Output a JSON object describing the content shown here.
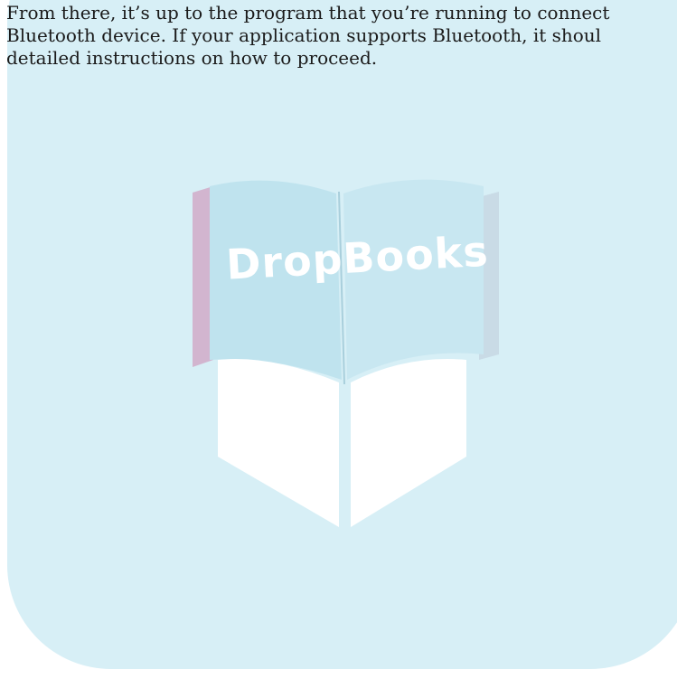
{
  "document": {
    "paragraph_lines": [
      "From there, it’s up to the program that you’re running to connect",
      "Bluetooth device. If your application supports Bluetooth, it shoul",
      "detailed instructions on how to proceed."
    ]
  },
  "watermark": {
    "logo_text": "DropBooks",
    "colors": {
      "background_tile": "#d7eff6",
      "book_pages": "#bfe3ee",
      "book_spine_shadow": "#c9a9c6",
      "book_stand": "#ffffff",
      "logo_text": "#ffffff"
    }
  }
}
